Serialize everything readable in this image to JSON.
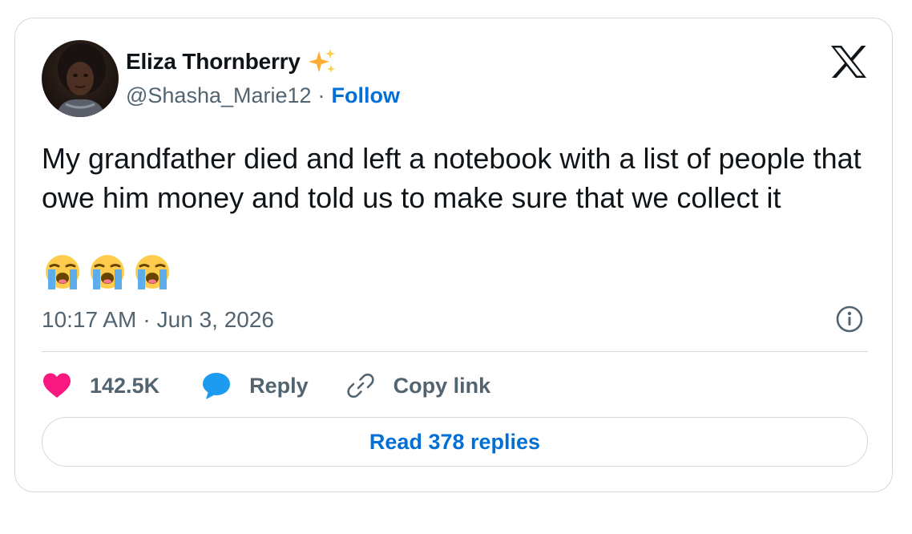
{
  "author": {
    "display_name": "Eliza Thornberry",
    "handle": "@Shasha_Marie12",
    "separator": "·",
    "follow_label": "Follow",
    "badge_icon": "sparkles-icon"
  },
  "tweet": {
    "text": "My grandfather died and left a notebook with a list of people that owe him money and told us to make sure that we collect it",
    "emojis": [
      "😭",
      "😭",
      "😭"
    ],
    "time": "10:17 AM",
    "date_separator": "·",
    "date": "Jun 3, 2026"
  },
  "actions": {
    "likes_count": "142.5K",
    "reply_label": "Reply",
    "copy_link_label": "Copy link"
  },
  "footer": {
    "read_replies_label": "Read 378 replies"
  },
  "colors": {
    "accent_blue": "#006fd6",
    "like_pink": "#f91880",
    "reply_blue": "#1d9bf0",
    "secondary_text": "#536471",
    "border": "#cfd9de"
  },
  "icons": {
    "platform_logo": "x-logo-icon",
    "info": "info-icon",
    "like": "heart-icon",
    "reply": "speech-bubble-icon",
    "copy_link": "link-icon"
  }
}
